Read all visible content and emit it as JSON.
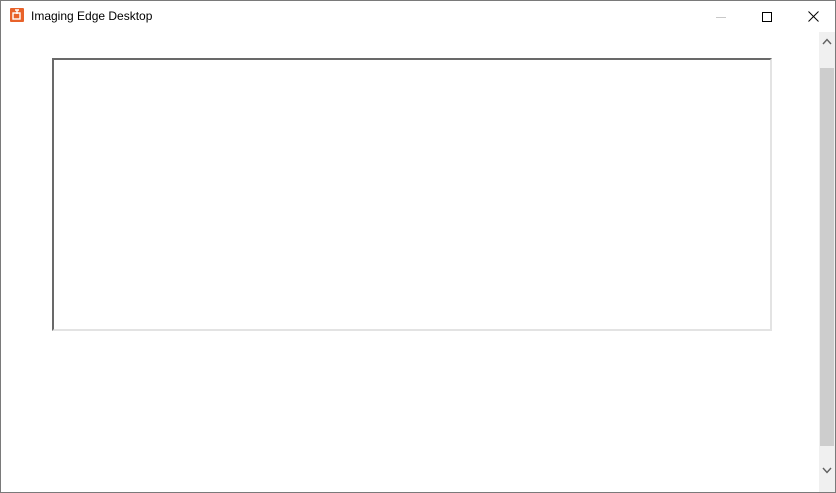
{
  "window": {
    "title": "Imaging Edge Desktop",
    "app_icon": "imaging-edge-app-icon",
    "accent_color": "#e8622a"
  },
  "caption_buttons": {
    "minimize_icon": "minimize-icon",
    "maximize_icon": "maximize-icon",
    "close_icon": "close-icon"
  },
  "scrollbar": {
    "up_icon": "chevron-up-icon",
    "down_icon": "chevron-down-icon"
  }
}
